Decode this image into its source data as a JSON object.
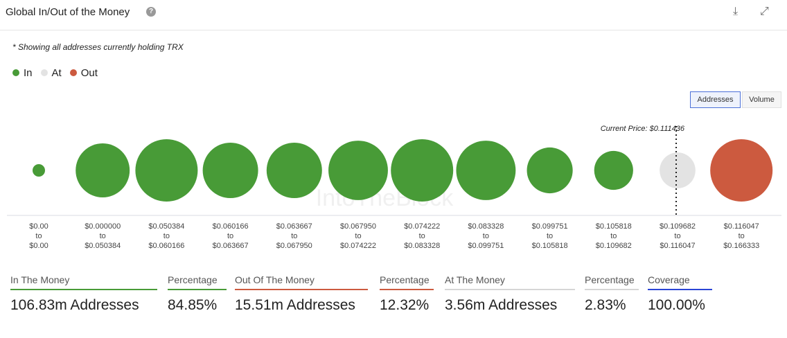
{
  "header": {
    "title": "Global In/Out of the Money",
    "help_icon": "question-circle-icon",
    "download_icon": "download-icon",
    "expand_icon": "expand-icon"
  },
  "note": "* Showing all addresses currently holding TRX",
  "legend": [
    {
      "label": "In",
      "color": "#489b37"
    },
    {
      "label": "At",
      "color": "#e3e3e3"
    },
    {
      "label": "Out",
      "color": "#cc5a3f"
    }
  ],
  "toggles": {
    "addresses": "Addresses",
    "volume": "Volume",
    "active": "Addresses"
  },
  "watermark": "IntoTheBlock",
  "chart_data": {
    "type": "bubble",
    "current_price_label": "Current Price: $0.111436",
    "current_price": 0.111436,
    "buckets": [
      {
        "from": "$0.00",
        "to": "$0.00",
        "status": "In",
        "relative_size": 0.04
      },
      {
        "from": "$0.000000",
        "to": "$0.050384",
        "status": "In",
        "relative_size": 0.75
      },
      {
        "from": "$0.050384",
        "to": "$0.060166",
        "status": "In",
        "relative_size": 1.0
      },
      {
        "from": "$0.060166",
        "to": "$0.063667",
        "status": "In",
        "relative_size": 0.79
      },
      {
        "from": "$0.063667",
        "to": "$0.067950",
        "status": "In",
        "relative_size": 0.79
      },
      {
        "from": "$0.067950",
        "to": "$0.074222",
        "status": "In",
        "relative_size": 0.91
      },
      {
        "from": "$0.074222",
        "to": "$0.083328",
        "status": "In",
        "relative_size": 1.0
      },
      {
        "from": "$0.083328",
        "to": "$0.099751",
        "status": "In",
        "relative_size": 0.91
      },
      {
        "from": "$0.099751",
        "to": "$0.105818",
        "status": "In",
        "relative_size": 0.54
      },
      {
        "from": "$0.105818",
        "to": "$0.109682",
        "status": "In",
        "relative_size": 0.39
      },
      {
        "from": "$0.109682",
        "to": "$0.116047",
        "status": "At",
        "relative_size": 0.33
      },
      {
        "from": "$0.116047",
        "to": "$0.166333",
        "status": "Out",
        "relative_size": 1.0
      }
    ],
    "to_word": "to"
  },
  "stats": [
    {
      "label": "In The Money",
      "value": "106.83m Addresses",
      "color": "#489b37"
    },
    {
      "label": "Percentage",
      "value": "84.85%",
      "color": "#489b37"
    },
    {
      "label": "Out Of The Money",
      "value": "15.51m Addresses",
      "color": "#cc5a3f"
    },
    {
      "label": "Percentage",
      "value": "12.32%",
      "color": "#cc5a3f"
    },
    {
      "label": "At The Money",
      "value": "3.56m Addresses",
      "color": "#d6d6d6"
    },
    {
      "label": "Percentage",
      "value": "2.83%",
      "color": "#d6d6d6"
    },
    {
      "label": "Coverage",
      "value": "100.00%",
      "color": "#2a44d6"
    }
  ]
}
